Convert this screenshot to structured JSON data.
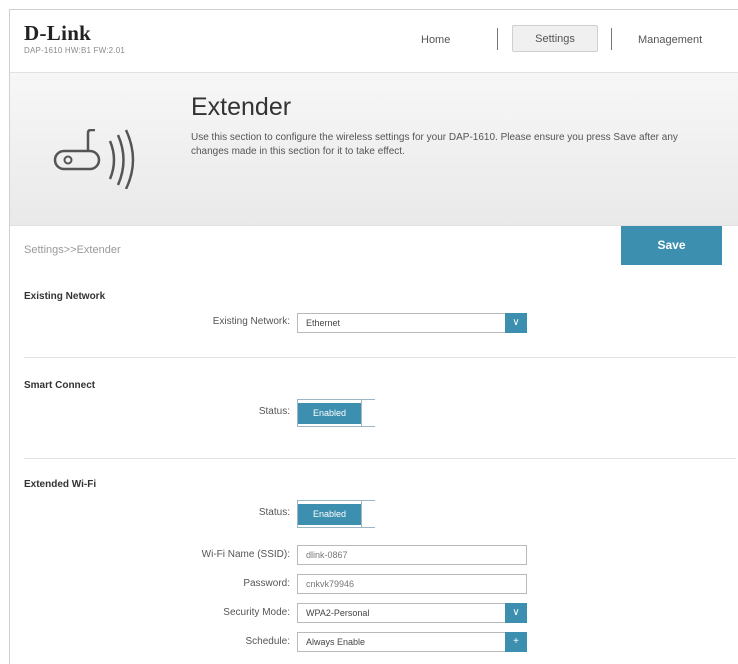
{
  "header": {
    "logo": "D-Link",
    "model": "DAP-1610 HW:B1 FW:2.01",
    "nav": {
      "home": "Home",
      "settings": "Settings",
      "management": "Management"
    }
  },
  "banner": {
    "title": "Extender",
    "description": "Use this section to configure the wireless settings for your DAP-1610. Please ensure you press Save after any changes made in this section for it to take effect.",
    "icon": "wireless-extender-icon"
  },
  "breadcrumb": "Settings>>Extender",
  "save_label": "Save",
  "existing_network": {
    "section_title": "Existing Network",
    "label": "Existing Network:",
    "value": "Ethernet"
  },
  "smart_connect": {
    "section_title": "Smart Connect",
    "status_label": "Status:",
    "status_value": "Enabled"
  },
  "extended_wifi": {
    "section_title": "Extended Wi-Fi",
    "status_label": "Status:",
    "status_value": "Enabled",
    "ssid_label": "Wi-Fi Name (SSID):",
    "ssid_value": "dlink-0867",
    "password_label": "Password:",
    "password_value": "cnkvk79946",
    "security_label": "Security Mode:",
    "security_value": "WPA2-Personal",
    "schedule_label": "Schedule:",
    "schedule_value": "Always Enable"
  },
  "colors": {
    "accent": "#3d8fb0"
  }
}
